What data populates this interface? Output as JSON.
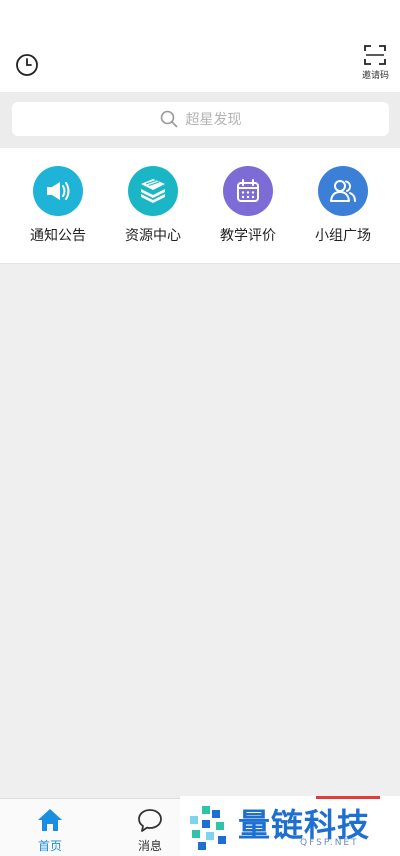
{
  "header": {
    "history_icon": "clock-icon",
    "invite": {
      "icon": "scan-frame-icon",
      "label": "邀请码"
    }
  },
  "search": {
    "icon": "search-icon",
    "placeholder": "超星发现"
  },
  "quick_access": [
    {
      "label": "通知公告",
      "icon": "megaphone-icon",
      "color": "#1fb3d8"
    },
    {
      "label": "资源中心",
      "icon": "book-stack-icon",
      "color": "#1bb6c6"
    },
    {
      "label": "教学评价",
      "icon": "calendar-icon",
      "color": "#7d6bd6"
    },
    {
      "label": "小组广场",
      "icon": "group-users-icon",
      "color": "#3b7fd6"
    }
  ],
  "tabbar": {
    "tabs": [
      {
        "label": "首页",
        "icon": "home-icon",
        "active": true,
        "color": "#1b8ee0"
      },
      {
        "label": "消息",
        "icon": "chat-bubble-icon",
        "active": false,
        "color": "#333333"
      }
    ]
  },
  "watermark": {
    "text": "量链科技",
    "sub": "QFSP.NET",
    "color": "#1d6fd1"
  }
}
